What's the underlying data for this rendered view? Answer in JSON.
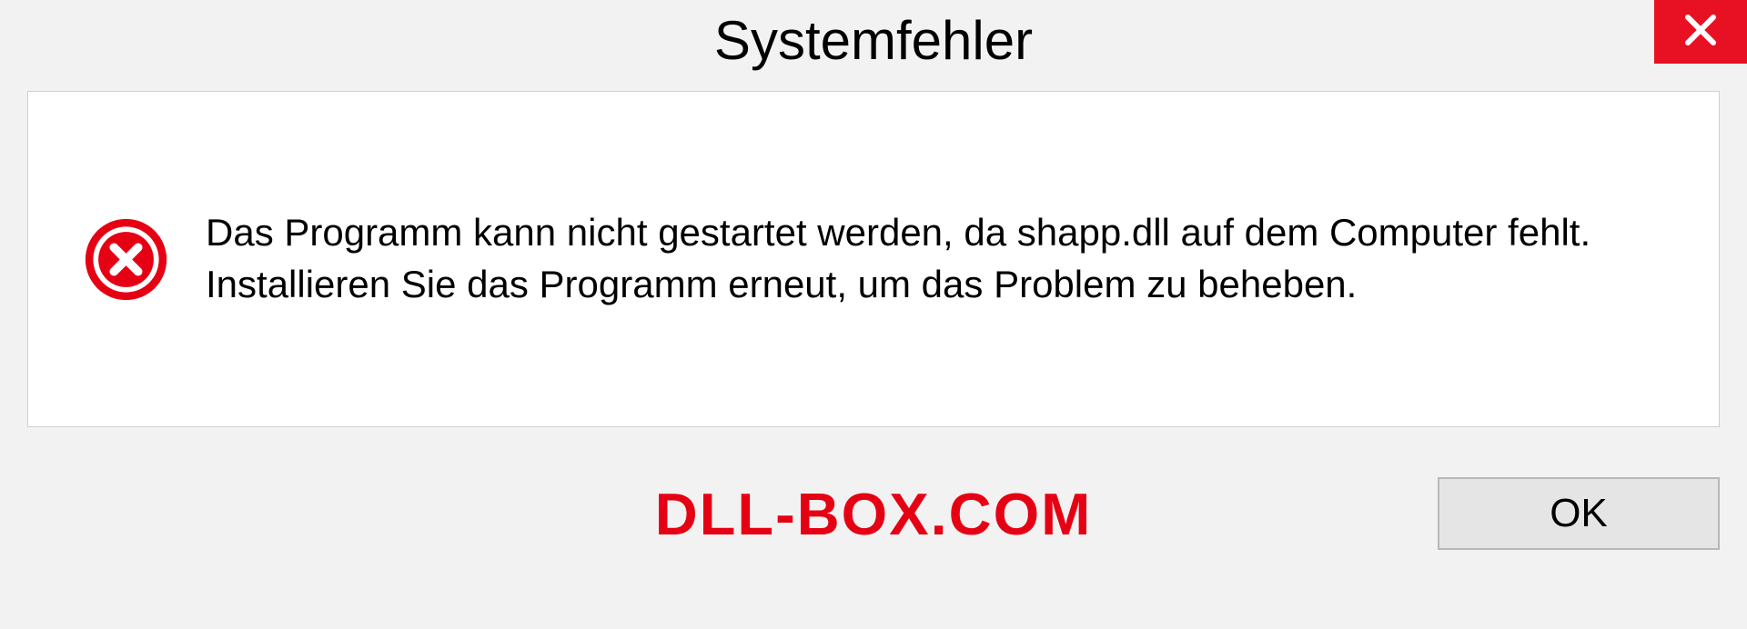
{
  "dialog": {
    "title": "Systemfehler",
    "message": "Das Programm kann nicht gestartet werden, da shapp.dll auf dem Computer fehlt. Installieren Sie das Programm erneut, um das Problem zu beheben.",
    "ok_label": "OK"
  },
  "watermark": "DLL-BOX.COM"
}
